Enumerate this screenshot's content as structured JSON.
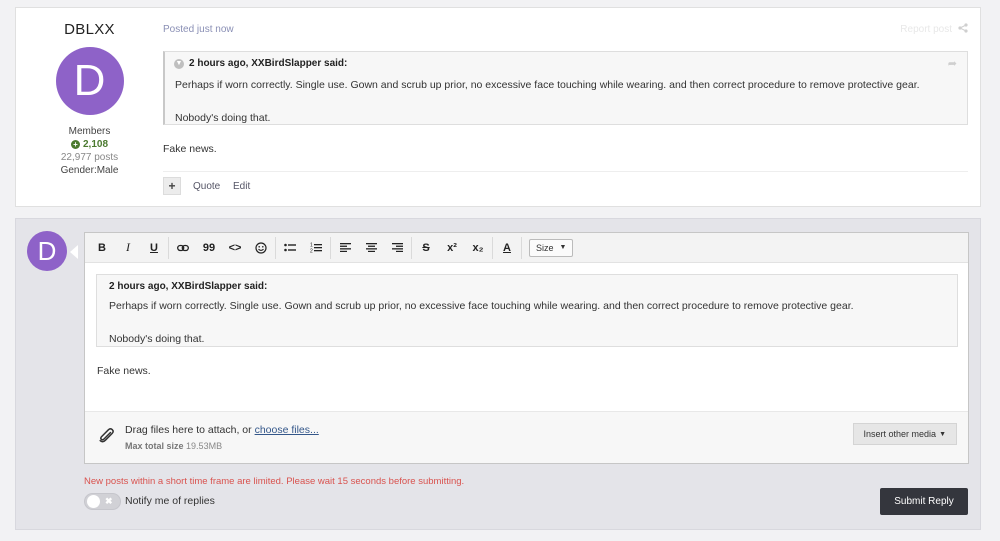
{
  "post": {
    "author_name": "DBLXX",
    "avatar_letter": "D",
    "member_group": "Members",
    "reputation": "2,108",
    "post_count": "22,977 posts",
    "gender": "Gender:Male",
    "posted_time": "Posted just now",
    "report_label": "Report post",
    "quote": {
      "header": "2 hours ago, XXBirdSlapper said:",
      "line1": "Perhaps if worn correctly. Single use. Gown and scrub up prior, no excessive face touching while wearing. and then correct procedure to remove protective gear.",
      "line2": "Nobody's doing that."
    },
    "text": "Fake news.",
    "actions": {
      "plus": "+",
      "quote": "Quote",
      "edit": "Edit"
    }
  },
  "reply": {
    "avatar_letter": "D",
    "toolbar": {
      "bold": "B",
      "italic": "I",
      "underline": "U",
      "quote": "99",
      "code": "<>",
      "strike": "S",
      "superscript": "x²",
      "subscript": "x₂",
      "text_color": "A",
      "size": "Size"
    },
    "editor_quote": {
      "header": "2 hours ago, XXBirdSlapper said:",
      "line1": "Perhaps if worn correctly. Single use. Gown and scrub up prior, no excessive face touching while wearing. and then correct procedure to remove protective gear.",
      "line2": "Nobody's doing that."
    },
    "editor_text": "Fake news.",
    "attach": {
      "text_prefix": "Drag files here to attach, or ",
      "choose_link": "choose files...",
      "max_label": "Max total size",
      "max_value": "19.53MB",
      "insert_media": "Insert other media"
    },
    "warning": "New posts within a short time frame are limited. Please wait 15 seconds before submitting.",
    "notify_label": "Notify me of replies",
    "submit_label": "Submit Reply"
  },
  "colors": {
    "avatar": "#8e62c8",
    "reputation": "#4b7a2f",
    "warning": "#d9534f",
    "submit": "#34363d",
    "link": "#34578a"
  }
}
